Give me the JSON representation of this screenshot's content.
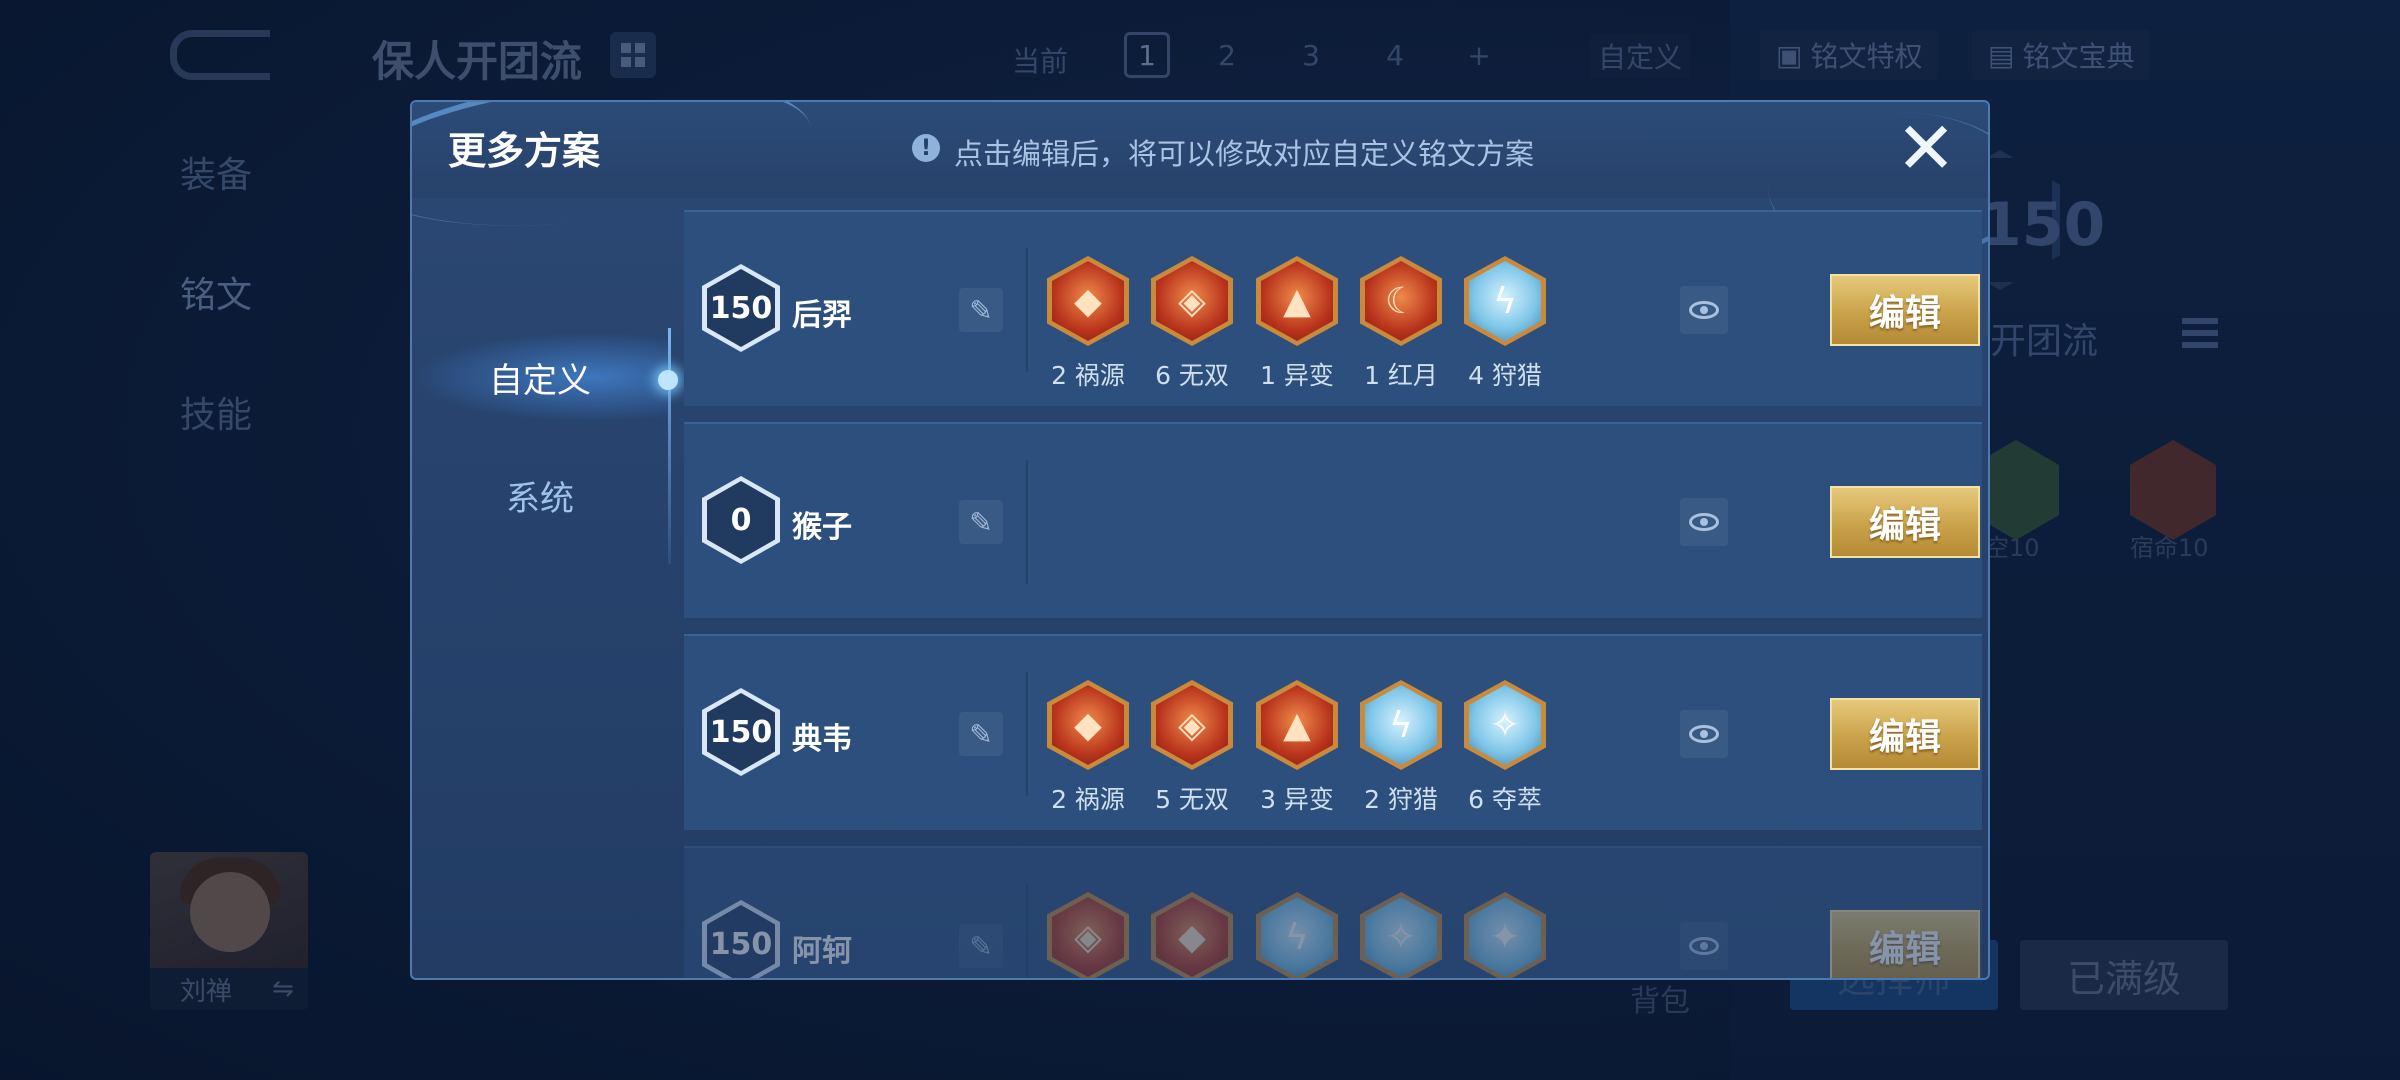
{
  "background": {
    "page_title": "保人开团流",
    "current_label": "当前",
    "pages": [
      "1",
      "2",
      "3",
      "4",
      "+"
    ],
    "custom_label": "自定义",
    "privilege_button": "铭文特权",
    "treasure_button": "铭文宝典",
    "left_nav": [
      "装备",
      "铭文",
      "技能"
    ],
    "hero_name": "刘禅",
    "swap_icon": "⇋",
    "bag_label": "背包",
    "recommend_button": "选择师",
    "max_level_button": "已满级",
    "right_level": "150",
    "right_scheme_name": "开团流",
    "right_runes": [
      {
        "label": "空10",
        "color": "green"
      },
      {
        "label": "宿命10",
        "color": "red"
      }
    ]
  },
  "modal": {
    "title": "更多方案",
    "hint_icon": "!",
    "hint": "点击编辑后，将可以修改对应自定义铭文方案",
    "close_icon": "✕",
    "tabs": [
      {
        "label": "自定义",
        "active": true
      },
      {
        "label": "系统",
        "active": false
      }
    ],
    "edit_label": "编辑",
    "schemes": [
      {
        "level": "150",
        "hero": "后羿",
        "runes": [
          {
            "label": "2 祸源",
            "color": "red"
          },
          {
            "label": "6 无双",
            "color": "red"
          },
          {
            "label": "1 异变",
            "color": "red"
          },
          {
            "label": "1 红月",
            "color": "red"
          },
          {
            "label": "4 狩猎",
            "color": "blue"
          }
        ]
      },
      {
        "level": "0",
        "hero": "猴子",
        "runes": []
      },
      {
        "level": "150",
        "hero": "典韦",
        "runes": [
          {
            "label": "2 祸源",
            "color": "red"
          },
          {
            "label": "5 无双",
            "color": "red"
          },
          {
            "label": "3 异变",
            "color": "red"
          },
          {
            "label": "2 狩猎",
            "color": "blue"
          },
          {
            "label": "6 夺萃",
            "color": "blue"
          }
        ]
      },
      {
        "level": "150",
        "hero": "阿轲",
        "runes": [
          {
            "label": "",
            "color": "red"
          },
          {
            "label": "",
            "color": "red"
          },
          {
            "label": "",
            "color": "blue"
          },
          {
            "label": "",
            "color": "blue"
          },
          {
            "label": "",
            "color": "blue"
          }
        ]
      }
    ]
  }
}
